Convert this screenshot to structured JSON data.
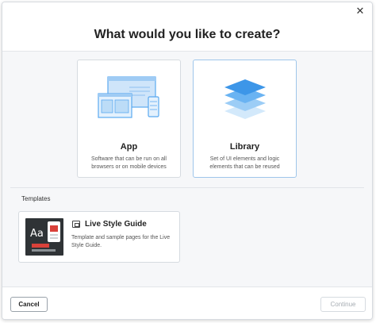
{
  "dialog": {
    "title": "What would you like to create?",
    "close_glyph": "✕"
  },
  "cards": [
    {
      "id": "app",
      "name": "App",
      "description": "Software that can be run on all browsers or on mobile devices",
      "icon": "devices-icon",
      "selected": false
    },
    {
      "id": "library",
      "name": "Library",
      "description": "Set of UI elements and logic elements that can be reused",
      "icon": "layers-icon",
      "selected": true
    }
  ],
  "templates": {
    "section_label": "Templates",
    "items": [
      {
        "name": "Live Style Guide",
        "description": "Template and sample pages for the Live Style Guide.",
        "thumbnail_text": "Aa",
        "icon": "template-icon"
      }
    ]
  },
  "footer": {
    "cancel_label": "Cancel",
    "continue_label": "Continue",
    "continue_enabled": false
  },
  "colors": {
    "accent_blue": "#5aa9f0",
    "light_blue": "#bcdcf7",
    "selected_border": "#9fc6ea",
    "thumb_red": "#d9413a"
  }
}
